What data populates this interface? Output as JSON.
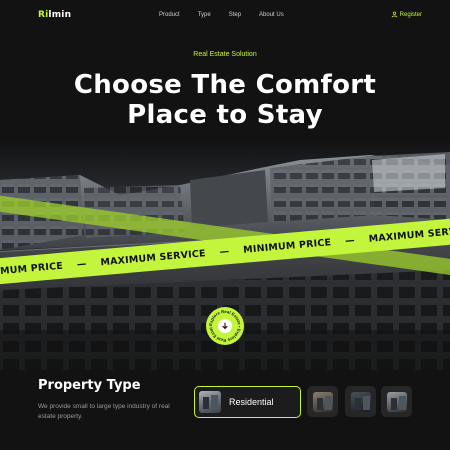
{
  "header": {
    "logo_prefix": "Ri",
    "logo_rest": "lmin",
    "nav": [
      "Product",
      "Type",
      "Step",
      "About Us"
    ],
    "register": "Register",
    "accent_color": "#c3f53c"
  },
  "hero": {
    "eyebrow": "Real Estate Solution",
    "headline_line1": "Choose The Comfort",
    "headline_line2": "Place to Stay"
  },
  "ribbon": {
    "items": [
      "MINIMUM PRICE",
      "—",
      "MAXIMUM SERVICE",
      "—",
      "MINIMUM PRICE",
      "—",
      "MAXIMUM SERVICE"
    ]
  },
  "scroll_badge": {
    "ring_text": "Explore Real Estate",
    "icon": "arrow-down-icon"
  },
  "property_type": {
    "title": "Property Type",
    "description": "We provide small to large type industry of real estate property.",
    "active_label": "Residential",
    "tiles": [
      "building-thumbnail",
      "building-thumbnail",
      "building-thumbnail"
    ]
  }
}
